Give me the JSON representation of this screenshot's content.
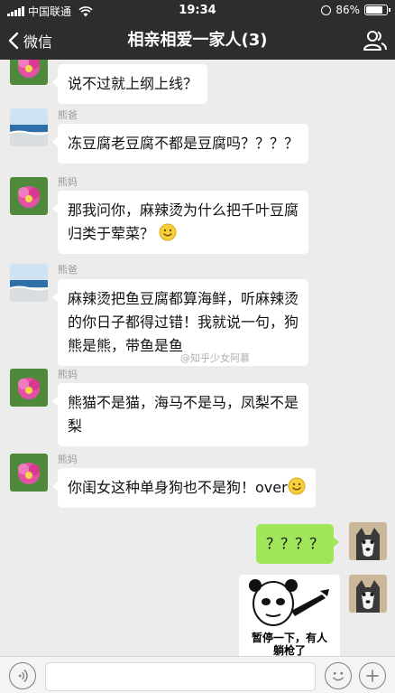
{
  "status_bar": {
    "carrier": "中国联通",
    "time": "19:34",
    "battery": "86%"
  },
  "nav": {
    "back_label": "微信",
    "title": "相亲相爱一家人(3)"
  },
  "messages": [
    {
      "sender": "",
      "text": "说不过就上纲上线？"
    },
    {
      "sender": "熊爸",
      "text": "冻豆腐老豆腐不都是豆腐吗？？？？"
    },
    {
      "sender": "熊妈",
      "line1": "那我问你，麻辣烫为什么把千叶豆腐",
      "line2": "归类于荤菜？"
    },
    {
      "sender": "熊爸",
      "line1": "麻辣烫把鱼豆腐都算海鲜，听麻辣烫",
      "line2": "的你日子都得过错！我就说一句，狗",
      "line3": "熊是熊，带鱼是鱼"
    },
    {
      "sender": "熊妈",
      "line1": "熊猫不是猫，海马不是马，凤梨不是",
      "line2": "梨"
    },
    {
      "sender": "熊妈",
      "text": "你闺女这种单身狗也不是狗！over"
    },
    {
      "sender": "me",
      "text": "？？？？"
    }
  ],
  "sticker": {
    "line1": "暂停一下，有人",
    "line2": "躺枪了"
  },
  "watermark": "@知乎少女阿慕",
  "colors": {
    "bar": "#2d2d2f",
    "chat_bg": "#ececec",
    "my_bubble": "#9fe658"
  }
}
